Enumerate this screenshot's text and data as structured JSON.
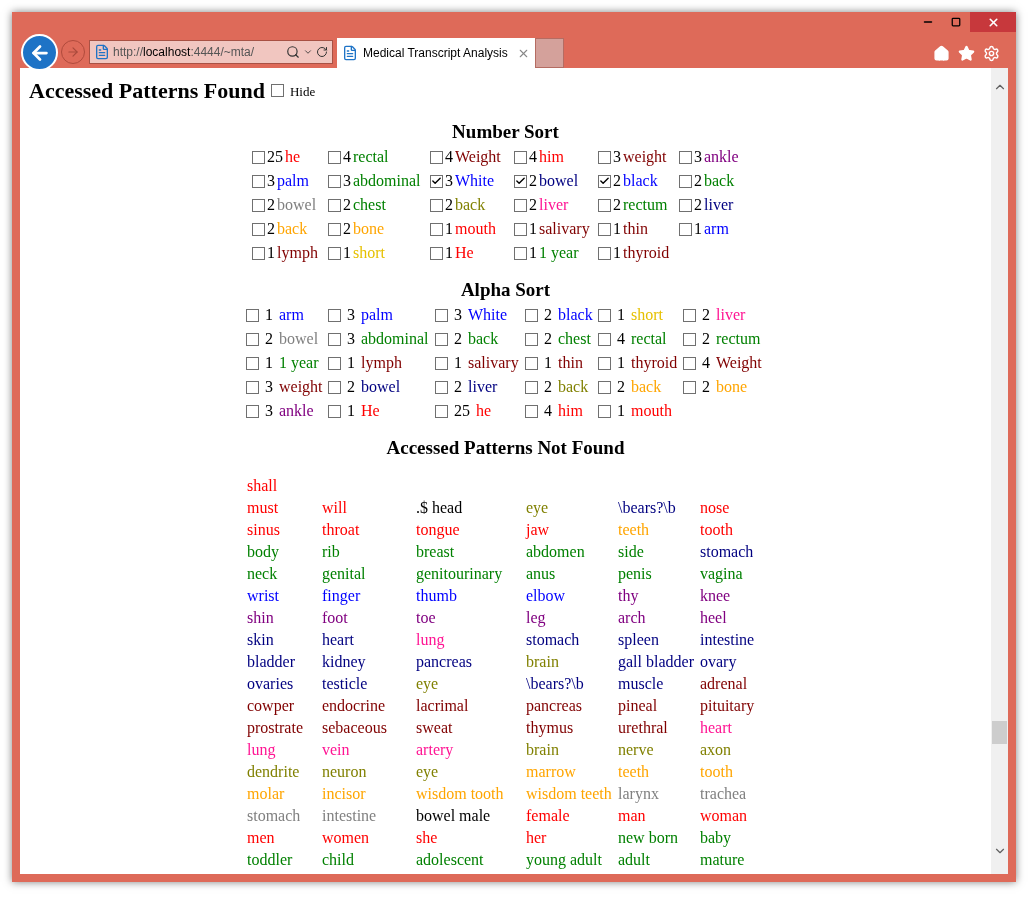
{
  "browser": {
    "address": {
      "scheme": "http://",
      "host": "localhost",
      "rest": ":4444/~mta/"
    },
    "tab": {
      "title": "Medical Transcript Analysis",
      "selected": true
    }
  },
  "found": {
    "title": "Accessed Patterns Found",
    "hide": {
      "label": "Hide",
      "checked": false
    }
  },
  "number_sort": {
    "title": "Number Sort",
    "items": [
      {
        "count": "25",
        "word": "he",
        "color": "#ff0000",
        "checked": false
      },
      {
        "count": "4",
        "word": "rectal",
        "color": "#008000",
        "checked": false
      },
      {
        "count": "4",
        "word": "Weight",
        "color": "#800000",
        "checked": false
      },
      {
        "count": "4",
        "word": "him",
        "color": "#ff0000",
        "checked": false
      },
      {
        "count": "3",
        "word": "weight",
        "color": "#800000",
        "checked": false
      },
      {
        "count": "3",
        "word": "ankle",
        "color": "#800080",
        "checked": false
      },
      {
        "count": "3",
        "word": "palm",
        "color": "#0000ff",
        "checked": false
      },
      {
        "count": "3",
        "word": "abdominal",
        "color": "#008000",
        "checked": false
      },
      {
        "count": "3",
        "word": "White",
        "color": "#0000ff",
        "checked": true
      },
      {
        "count": "2",
        "word": "bowel",
        "color": "#000080",
        "checked": true
      },
      {
        "count": "2",
        "word": "black",
        "color": "#0000ff",
        "checked": true
      },
      {
        "count": "2",
        "word": "back",
        "color": "#008000",
        "checked": false
      },
      {
        "count": "2",
        "word": "bowel",
        "color": "#808080",
        "checked": false
      },
      {
        "count": "2",
        "word": "chest",
        "color": "#008000",
        "checked": false
      },
      {
        "count": "2",
        "word": "back",
        "color": "#808000",
        "checked": false
      },
      {
        "count": "2",
        "word": "liver",
        "color": "#ff1493",
        "checked": false
      },
      {
        "count": "2",
        "word": "rectum",
        "color": "#008000",
        "checked": false
      },
      {
        "count": "2",
        "word": "liver",
        "color": "#000080",
        "checked": false
      },
      {
        "count": "2",
        "word": "back",
        "color": "#ffa500",
        "checked": false
      },
      {
        "count": "2",
        "word": "bone",
        "color": "#ffa500",
        "checked": false
      },
      {
        "count": "1",
        "word": "mouth",
        "color": "#ff0000",
        "checked": false
      },
      {
        "count": "1",
        "word": "salivary",
        "color": "#800000",
        "checked": false
      },
      {
        "count": "1",
        "word": "thin",
        "color": "#800000",
        "checked": false
      },
      {
        "count": "1",
        "word": "arm",
        "color": "#0000ff",
        "checked": false
      },
      {
        "count": "1",
        "word": "lymph",
        "color": "#800000",
        "checked": false
      },
      {
        "count": "1",
        "word": "short",
        "color": "#e6c000",
        "checked": false
      },
      {
        "count": "1",
        "word": "He",
        "color": "#ff0000",
        "checked": false
      },
      {
        "count": "1",
        "word": "1 year",
        "color": "#008000",
        "checked": false
      },
      {
        "count": "1",
        "word": "thyroid",
        "color": "#800000",
        "checked": false
      }
    ]
  },
  "alpha_sort": {
    "title": "Alpha Sort",
    "items": [
      {
        "count": "1",
        "word": "arm",
        "color": "#0000ff",
        "checked": false
      },
      {
        "count": "3",
        "word": "palm",
        "color": "#0000ff",
        "checked": false
      },
      {
        "count": "3",
        "word": "White",
        "color": "#0000ff",
        "checked": false
      },
      {
        "count": "2",
        "word": "black",
        "color": "#0000ff",
        "checked": false
      },
      {
        "count": "1",
        "word": "short",
        "color": "#e6c000",
        "checked": false
      },
      {
        "count": "2",
        "word": "liver",
        "color": "#ff1493",
        "checked": false
      },
      {
        "count": "2",
        "word": "bowel",
        "color": "#808080",
        "checked": false
      },
      {
        "count": "3",
        "word": "abdominal",
        "color": "#008000",
        "checked": false
      },
      {
        "count": "2",
        "word": "back",
        "color": "#008000",
        "checked": false
      },
      {
        "count": "2",
        "word": "chest",
        "color": "#008000",
        "checked": false
      },
      {
        "count": "4",
        "word": "rectal",
        "color": "#008000",
        "checked": false
      },
      {
        "count": "2",
        "word": "rectum",
        "color": "#008000",
        "checked": false
      },
      {
        "count": "1",
        "word": "1 year",
        "color": "#008000",
        "checked": false
      },
      {
        "count": "1",
        "word": "lymph",
        "color": "#800000",
        "checked": false
      },
      {
        "count": "1",
        "word": "salivary",
        "color": "#800000",
        "checked": false
      },
      {
        "count": "1",
        "word": "thin",
        "color": "#800000",
        "checked": false
      },
      {
        "count": "1",
        "word": "thyroid",
        "color": "#800000",
        "checked": false
      },
      {
        "count": "4",
        "word": "Weight",
        "color": "#800000",
        "checked": false
      },
      {
        "count": "3",
        "word": "weight",
        "color": "#800000",
        "checked": false
      },
      {
        "count": "2",
        "word": "bowel",
        "color": "#000080",
        "checked": false
      },
      {
        "count": "2",
        "word": "liver",
        "color": "#000080",
        "checked": false
      },
      {
        "count": "2",
        "word": "back",
        "color": "#808000",
        "checked": false
      },
      {
        "count": "2",
        "word": "back",
        "color": "#ffa500",
        "checked": false
      },
      {
        "count": "2",
        "word": "bone",
        "color": "#ffa500",
        "checked": false
      },
      {
        "count": "3",
        "word": "ankle",
        "color": "#800080",
        "checked": false
      },
      {
        "count": "1",
        "word": "He",
        "color": "#ff0000",
        "checked": false
      },
      {
        "count": "25",
        "word": "he",
        "color": "#ff0000",
        "checked": false
      },
      {
        "count": "4",
        "word": "him",
        "color": "#ff0000",
        "checked": false
      },
      {
        "count": "1",
        "word": "mouth",
        "color": "#ff0000",
        "checked": false
      }
    ]
  },
  "not_found": {
    "title": "Accessed Patterns Not Found",
    "rows": [
      [
        {
          "text": "shall",
          "color": "#ff0000"
        }
      ],
      [
        {
          "text": "must",
          "color": "#ff0000"
        },
        {
          "text": "will",
          "color": "#ff0000"
        },
        {
          "text": ".$ head",
          "color": "#000000"
        },
        {
          "text": "eye",
          "color": "#808000"
        },
        {
          "text": "\\bears?\\b",
          "color": "#000080"
        },
        {
          "text": "nose",
          "color": "#ff0000"
        }
      ],
      [
        {
          "text": "sinus",
          "color": "#ff0000"
        },
        {
          "text": "throat",
          "color": "#ff0000"
        },
        {
          "text": "tongue",
          "color": "#ff0000"
        },
        {
          "text": "jaw",
          "color": "#ff0000"
        },
        {
          "text": "teeth",
          "color": "#ffa500"
        },
        {
          "text": "tooth",
          "color": "#ff0000"
        }
      ],
      [
        {
          "text": "body",
          "color": "#008000"
        },
        {
          "text": "rib",
          "color": "#008000"
        },
        {
          "text": "breast",
          "color": "#008000"
        },
        {
          "text": "abdomen",
          "color": "#008000"
        },
        {
          "text": "side",
          "color": "#008000"
        },
        {
          "text": "stomach",
          "color": "#000080"
        }
      ],
      [
        {
          "text": "neck",
          "color": "#008000"
        },
        {
          "text": "genital",
          "color": "#008000"
        },
        {
          "text": "genitourinary",
          "color": "#008000"
        },
        {
          "text": "anus",
          "color": "#008000"
        },
        {
          "text": "penis",
          "color": "#008000"
        },
        {
          "text": "vagina",
          "color": "#008000"
        }
      ],
      [
        {
          "text": "wrist",
          "color": "#0000ff"
        },
        {
          "text": "finger",
          "color": "#0000ff"
        },
        {
          "text": "thumb",
          "color": "#0000ff"
        },
        {
          "text": "elbow",
          "color": "#0000ff"
        },
        {
          "text": "thy",
          "color": "#800080"
        },
        {
          "text": "knee",
          "color": "#800080"
        }
      ],
      [
        {
          "text": "shin",
          "color": "#800080"
        },
        {
          "text": "foot",
          "color": "#800080"
        },
        {
          "text": "toe",
          "color": "#800080"
        },
        {
          "text": "leg",
          "color": "#800080"
        },
        {
          "text": "arch",
          "color": "#800080"
        },
        {
          "text": "heel",
          "color": "#800080"
        }
      ],
      [
        {
          "text": "skin",
          "color": "#000080"
        },
        {
          "text": "heart",
          "color": "#000080"
        },
        {
          "text": "lung",
          "color": "#ff1493"
        },
        {
          "text": "stomach",
          "color": "#000080"
        },
        {
          "text": "spleen",
          "color": "#000080"
        },
        {
          "text": "intestine",
          "color": "#000080"
        }
      ],
      [
        {
          "text": "bladder",
          "color": "#000080"
        },
        {
          "text": "kidney",
          "color": "#000080"
        },
        {
          "text": "pancreas",
          "color": "#000080"
        },
        {
          "text": "brain",
          "color": "#808000"
        },
        {
          "text": "gall bladder",
          "color": "#000080"
        },
        {
          "text": "ovary",
          "color": "#000080"
        }
      ],
      [
        {
          "text": "ovaries",
          "color": "#000080"
        },
        {
          "text": "testicle",
          "color": "#000080"
        },
        {
          "text": "eye",
          "color": "#808000"
        },
        {
          "text": "\\bears?\\b",
          "color": "#000080"
        },
        {
          "text": "muscle",
          "color": "#000080"
        },
        {
          "text": "adrenal",
          "color": "#800000"
        }
      ],
      [
        {
          "text": "cowper",
          "color": "#800000"
        },
        {
          "text": "endocrine",
          "color": "#800000"
        },
        {
          "text": "lacrimal",
          "color": "#800000"
        },
        {
          "text": "pancreas",
          "color": "#800000"
        },
        {
          "text": "pineal",
          "color": "#800000"
        },
        {
          "text": "pituitary",
          "color": "#800000"
        }
      ],
      [
        {
          "text": "prostrate",
          "color": "#800000"
        },
        {
          "text": "sebaceous",
          "color": "#800000"
        },
        {
          "text": "sweat",
          "color": "#800000"
        },
        {
          "text": "thymus",
          "color": "#800000"
        },
        {
          "text": "urethral",
          "color": "#800000"
        },
        {
          "text": "heart",
          "color": "#ff1493"
        }
      ],
      [
        {
          "text": "lung",
          "color": "#ff1493"
        },
        {
          "text": "vein",
          "color": "#ff1493"
        },
        {
          "text": "artery",
          "color": "#ff1493"
        },
        {
          "text": "brain",
          "color": "#808000"
        },
        {
          "text": "nerve",
          "color": "#808000"
        },
        {
          "text": "axon",
          "color": "#808000"
        }
      ],
      [
        {
          "text": "dendrite",
          "color": "#808000"
        },
        {
          "text": "neuron",
          "color": "#808000"
        },
        {
          "text": "eye",
          "color": "#808000"
        },
        {
          "text": "marrow",
          "color": "#ffa500"
        },
        {
          "text": "teeth",
          "color": "#ffa500"
        },
        {
          "text": "tooth",
          "color": "#ffa500"
        }
      ],
      [
        {
          "text": "molar",
          "color": "#ffa500"
        },
        {
          "text": "incisor",
          "color": "#ffa500"
        },
        {
          "text": "wisdom tooth",
          "color": "#ffa500"
        },
        {
          "text": "wisdom teeth",
          "color": "#ffa500"
        },
        {
          "text": "larynx",
          "color": "#808080"
        },
        {
          "text": "trachea",
          "color": "#808080"
        }
      ],
      [
        {
          "text": "stomach",
          "color": "#808080"
        },
        {
          "text": "intestine",
          "color": "#808080"
        },
        {
          "text": "bowel male",
          "color": "#000000"
        },
        {
          "text": "female",
          "color": "#ff0000"
        },
        {
          "text": "man",
          "color": "#ff0000"
        },
        {
          "text": "woman",
          "color": "#ff0000"
        }
      ],
      [
        {
          "text": "men",
          "color": "#ff0000"
        },
        {
          "text": "women",
          "color": "#ff0000"
        },
        {
          "text": "she",
          "color": "#ff0000"
        },
        {
          "text": "her",
          "color": "#ff0000"
        },
        {
          "text": "new born",
          "color": "#008000"
        },
        {
          "text": "baby",
          "color": "#008000"
        }
      ],
      [
        {
          "text": "toddler",
          "color": "#008000"
        },
        {
          "text": "child",
          "color": "#008000"
        },
        {
          "text": "adolescent",
          "color": "#008000"
        },
        {
          "text": "young adult",
          "color": "#008000"
        },
        {
          "text": "adult",
          "color": "#008000"
        },
        {
          "text": "mature",
          "color": "#008000"
        }
      ]
    ]
  }
}
